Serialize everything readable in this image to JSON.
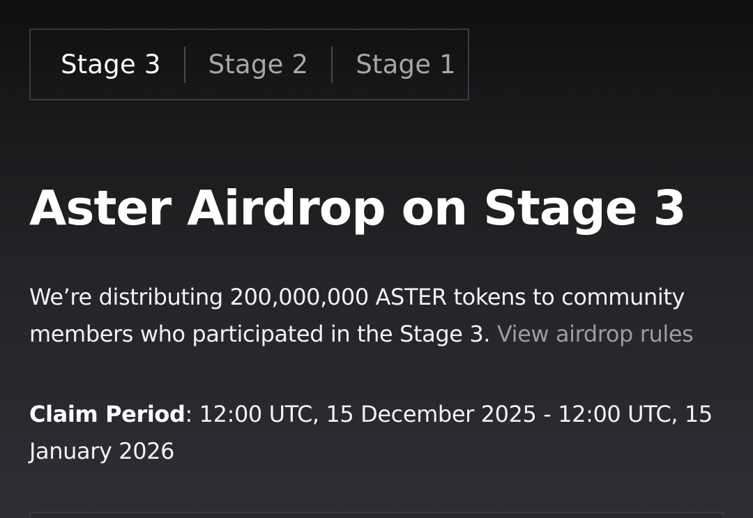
{
  "stage_tabs": [
    {
      "label": "Stage 3",
      "active": true
    },
    {
      "label": "Stage 2",
      "active": false
    },
    {
      "label": "Stage 1",
      "active": false
    }
  ],
  "title": "Aster Airdrop on Stage 3",
  "description": {
    "text": "We’re distributing 200,000,000 ASTER tokens to community members who participated in the Stage 3. ",
    "link_label": "View airdrop rules"
  },
  "claim_period": {
    "label": "Claim Period",
    "separator": ": ",
    "value": "12:00 UTC, 15 December 2025 - 12:00 UTC, 15 January 2026"
  },
  "colors": {
    "background_top": "#0f0f10",
    "background_bottom": "#2f2d36",
    "text_primary": "#ffffff",
    "text_muted": "#a7a7ab",
    "link": "#9d9d9d",
    "border": "#3b3b3f"
  }
}
